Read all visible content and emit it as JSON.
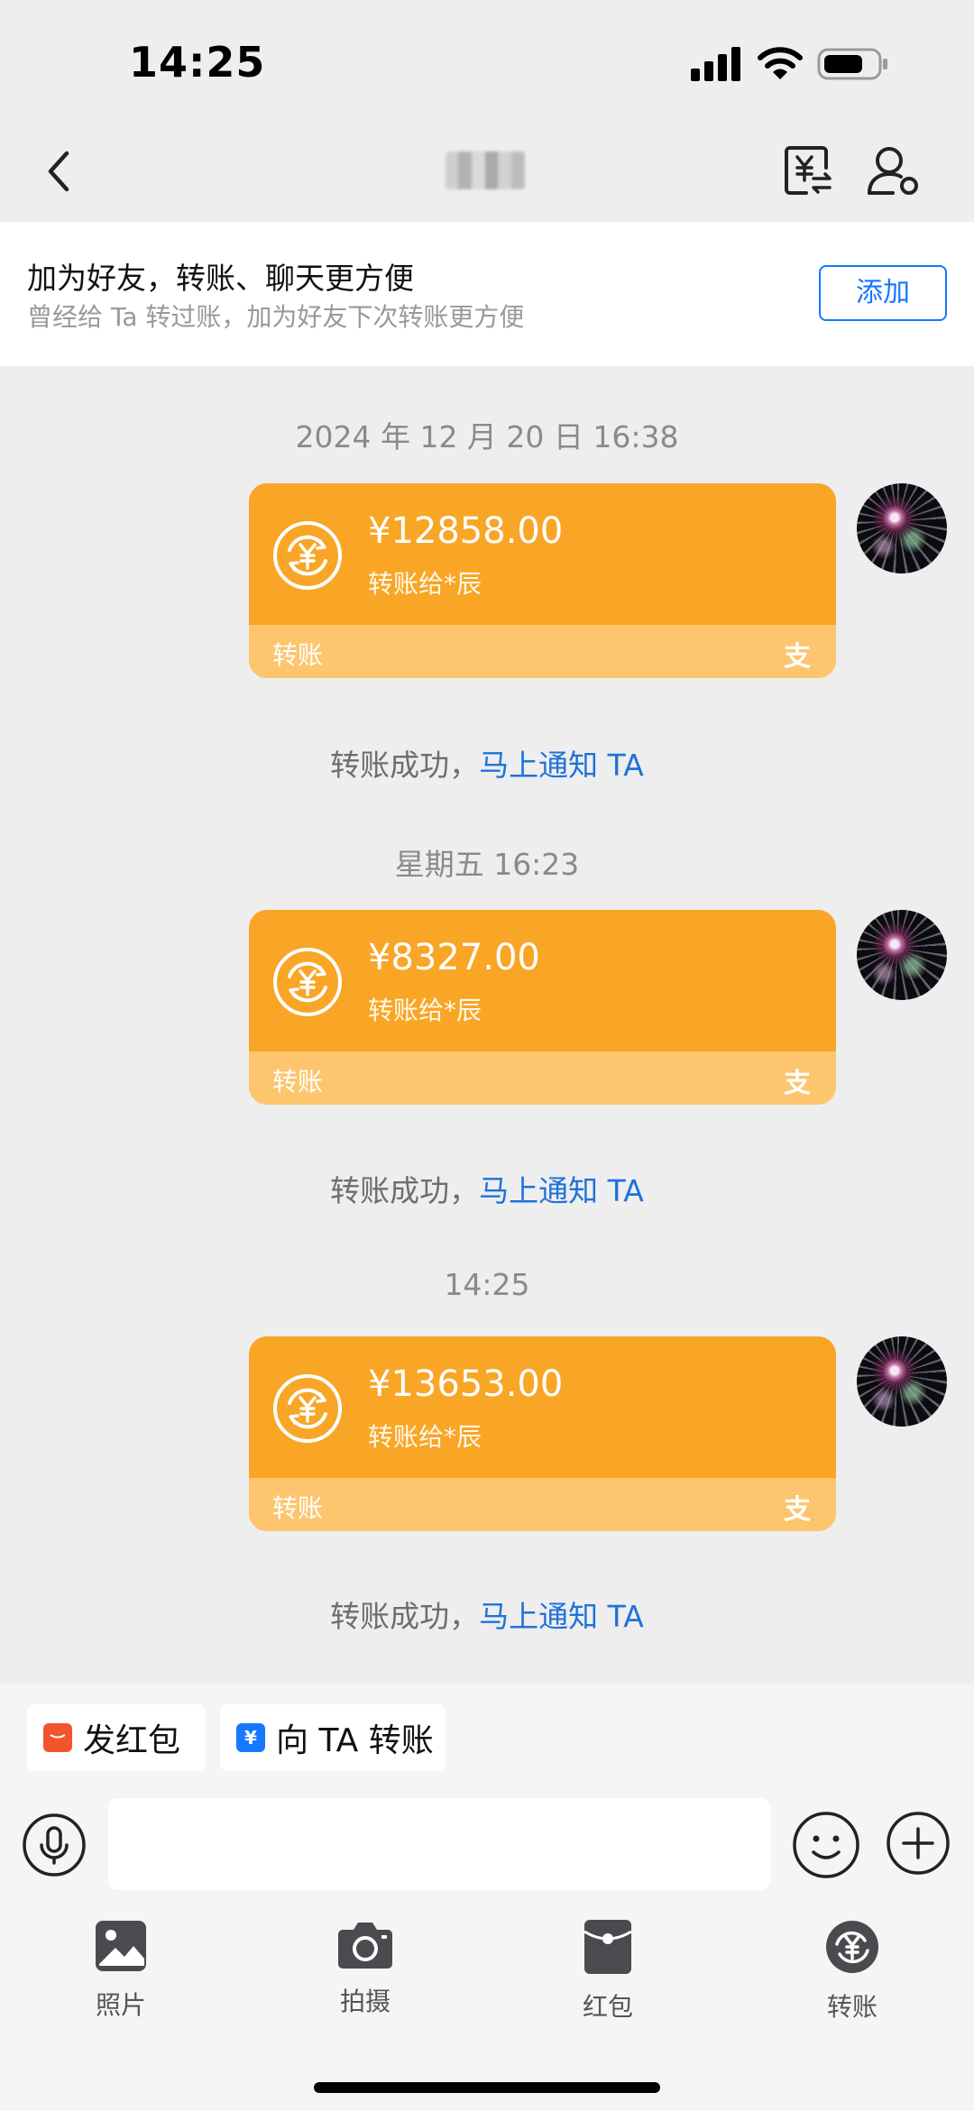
{
  "status_bar": {
    "time": "14:25"
  },
  "header": {
    "contact_name": "■■"
  },
  "banner": {
    "title": "加为好友，转账、聊天更方便",
    "subtitle": "曾经给 Ta 转过账，加为好友下次转账更方便",
    "add_label": "添加"
  },
  "messages": [
    {
      "timestamp": "2024 年 12 月 20 日 16:38",
      "amount": "¥12858.00",
      "recipient": "转账给*辰",
      "card_label": "转账",
      "brand_glyph": "支",
      "notice_prefix": "转账成功，",
      "notice_link": "马上通知 TA"
    },
    {
      "timestamp": "星期五 16:23",
      "amount": "¥8327.00",
      "recipient": "转账给*辰",
      "card_label": "转账",
      "brand_glyph": "支",
      "notice_prefix": "转账成功，",
      "notice_link": "马上通知 TA"
    },
    {
      "timestamp": "14:25",
      "amount": "¥13653.00",
      "recipient": "转账给*辰",
      "card_label": "转账",
      "brand_glyph": "支",
      "notice_prefix": "转账成功，",
      "notice_link": "马上通知 TA"
    }
  ],
  "quick_actions": {
    "red_packet": "发红包",
    "transfer": "向 TA 转账",
    "transfer_icon_glyph": "¥"
  },
  "input": {
    "placeholder": ""
  },
  "toolbar": {
    "photo": "照片",
    "camera": "拍摄",
    "red_packet": "红包",
    "transfer": "转账"
  },
  "colors": {
    "card_orange": "#f9a526",
    "card_footer": "#fdc56e",
    "link_blue": "#1f73d8",
    "accent_blue": "#1677ff"
  }
}
